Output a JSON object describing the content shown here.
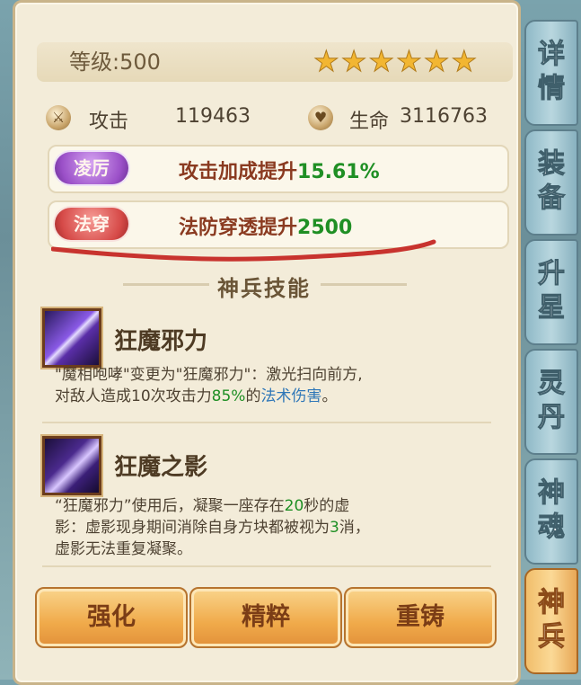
{
  "header": {
    "level_text": "等级:500",
    "stars_filled": 6,
    "stars_total": 6
  },
  "stats": {
    "attack_label": "攻击",
    "attack_value": "119463",
    "life_label": "生命",
    "life_value": "3116763"
  },
  "attributes": [
    {
      "badge": "凌厉",
      "prefix": "攻击加成提升",
      "value": "15.61%"
    },
    {
      "badge": "法穿",
      "prefix": "法防穿透提升",
      "value": "2500"
    }
  ],
  "section": {
    "title": "神兵技能"
  },
  "skills": [
    {
      "name": "狂魔邪力",
      "desc_line1": "\"魔相咆哮\"变更为\"狂魔邪力\"：激光扫向前方,",
      "desc_line2_a": "对敌人造成10次攻击力",
      "desc_line2_pct": "85%",
      "desc_line2_b": "的",
      "desc_line2_link": "法术伤害",
      "desc_line2_c": "。"
    },
    {
      "name": "狂魔之影",
      "desc_line1_a": "“狂魔邪力”使用后，凝聚一座存在",
      "desc_line1_num": "20",
      "desc_line1_b": "秒的虚",
      "desc_line2_a": "影：虚影现身期间消除自身方块都被视为",
      "desc_line2_num": "3",
      "desc_line2_b": "消，",
      "desc_line3": "虚影无法重复凝聚。"
    }
  ],
  "buttons": {
    "enhance": "强化",
    "refine": "精粹",
    "recast": "重铸"
  },
  "side_tabs": [
    {
      "line1": "详",
      "line2": "情"
    },
    {
      "line1": "装",
      "line2": "备"
    },
    {
      "line1": "升",
      "line2": "星"
    },
    {
      "line1": "灵",
      "line2": "丹"
    },
    {
      "line1": "神",
      "line2": "魂"
    },
    {
      "line1": "神",
      "line2": "兵"
    }
  ],
  "colors": {
    "accent_green": "#1f8f24",
    "link_blue": "#2f77b8",
    "annotation_red": "#c8332e"
  },
  "icons": {
    "attack": "sword-icon",
    "life": "heart-icon"
  }
}
